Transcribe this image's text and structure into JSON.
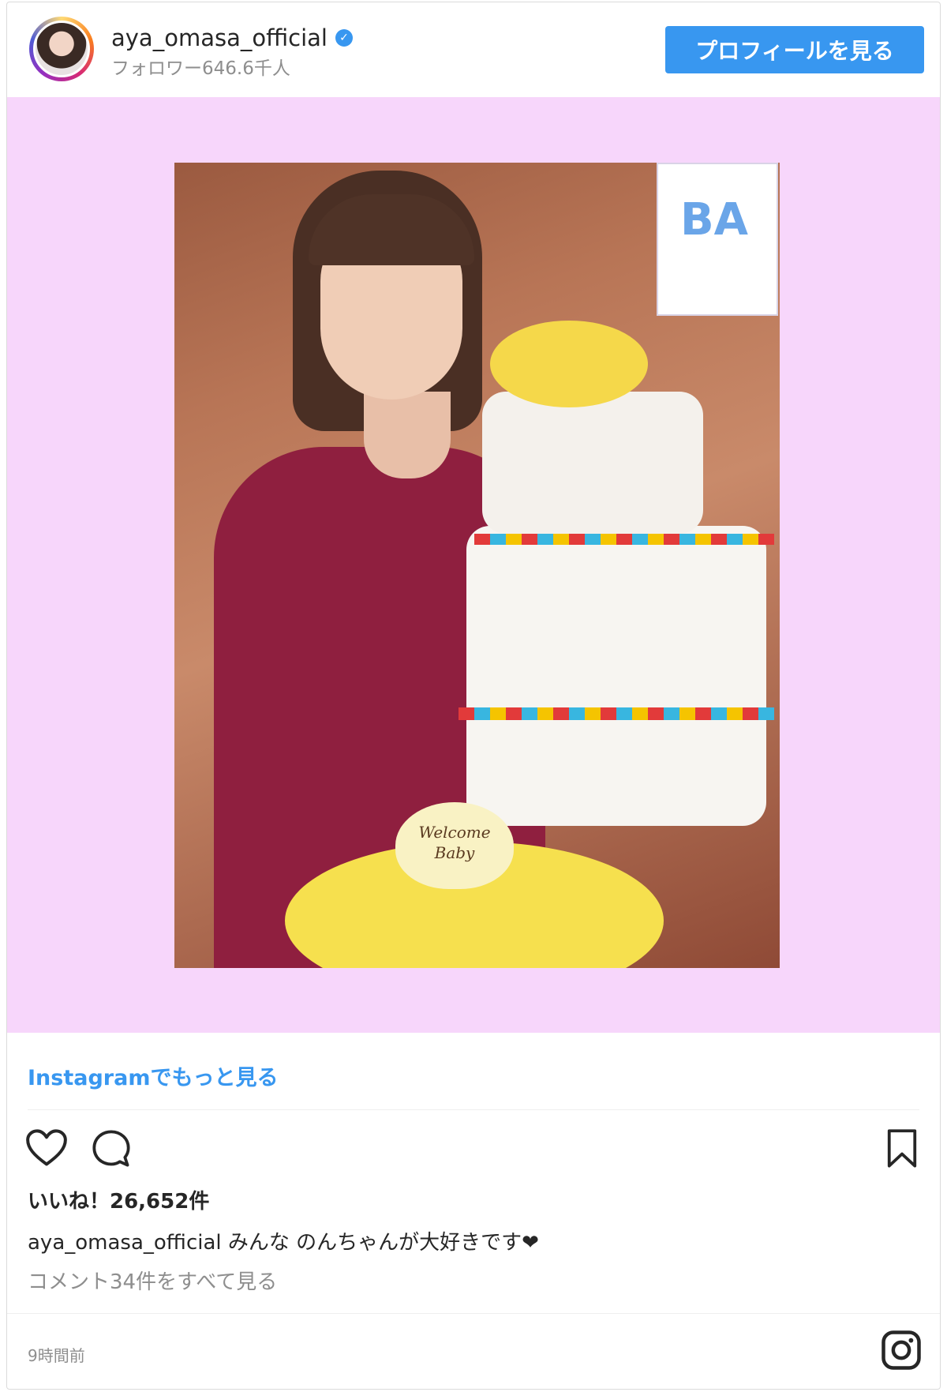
{
  "header": {
    "username": "aya_omasa_official",
    "verified_mark": "✓",
    "followers": "フォロワー646.6千人",
    "profile_button": "プロフィールを見る"
  },
  "photo": {
    "banner_text": "BA",
    "plaque_text": "Welcome Baby"
  },
  "links": {
    "more_on_instagram": "Instagramでもっと見る"
  },
  "actions": {
    "icons": [
      "heart-icon",
      "comment-icon",
      "bookmark-icon"
    ]
  },
  "post": {
    "likes": "いいね！26,652件",
    "caption_user": "aya_omasa_official",
    "caption_text": " みんな のんちゃんが大好きです❤",
    "view_comments": "コメント34件をすべて見る",
    "timestamp": "9時間前"
  },
  "colors": {
    "accent": "#3897f0",
    "media_background": "#f7d6fb"
  }
}
